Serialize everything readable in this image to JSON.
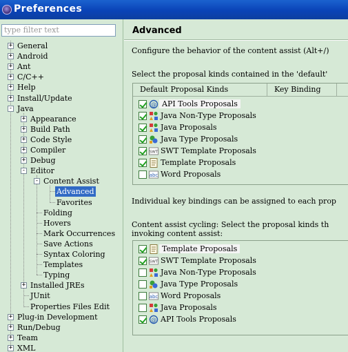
{
  "window": {
    "title": "Preferences"
  },
  "filter": {
    "placeholder": "type filter text"
  },
  "tree": [
    {
      "label": "General",
      "toggle": "+"
    },
    {
      "label": "Android",
      "toggle": "+"
    },
    {
      "label": "Ant",
      "toggle": "+"
    },
    {
      "label": "C/C++",
      "toggle": "+"
    },
    {
      "label": "Help",
      "toggle": "+"
    },
    {
      "label": "Install/Update",
      "toggle": "+"
    },
    {
      "label": "Java",
      "toggle": "-"
    },
    {
      "label": "Appearance",
      "toggle": "+"
    },
    {
      "label": "Build Path",
      "toggle": "+"
    },
    {
      "label": "Code Style",
      "toggle": "+"
    },
    {
      "label": "Compiler",
      "toggle": "+"
    },
    {
      "label": "Debug",
      "toggle": "+"
    },
    {
      "label": "Editor",
      "toggle": "-"
    },
    {
      "label": "Content Assist",
      "toggle": "-"
    },
    {
      "label": "Advanced",
      "toggle": ""
    },
    {
      "label": "Favorites",
      "toggle": ""
    },
    {
      "label": "Folding",
      "toggle": ""
    },
    {
      "label": "Hovers",
      "toggle": ""
    },
    {
      "label": "Mark Occurrences",
      "toggle": ""
    },
    {
      "label": "Save Actions",
      "toggle": ""
    },
    {
      "label": "Syntax Coloring",
      "toggle": ""
    },
    {
      "label": "Templates",
      "toggle": ""
    },
    {
      "label": "Typing",
      "toggle": ""
    },
    {
      "label": "Installed JREs",
      "toggle": "+"
    },
    {
      "label": "JUnit",
      "toggle": ""
    },
    {
      "label": "Properties Files Edit",
      "toggle": ""
    },
    {
      "label": "Plug-in Development",
      "toggle": "+"
    },
    {
      "label": "Run/Debug",
      "toggle": "+"
    },
    {
      "label": "Team",
      "toggle": "+"
    },
    {
      "label": "XML",
      "toggle": "+"
    }
  ],
  "page": {
    "title": "Advanced",
    "description": "Configure the behavior of the content assist (Alt+/)",
    "default_section_label": "Select the proposal kinds contained in the 'default'",
    "columns": {
      "kinds": "Default Proposal Kinds",
      "binding": "Key Binding"
    },
    "default_kinds": [
      {
        "label": "API Tools Proposals",
        "checked": true,
        "icon": "api-tools-icon"
      },
      {
        "label": "Java Non-Type Proposals",
        "checked": true,
        "icon": "java-non-type-icon"
      },
      {
        "label": "Java Proposals",
        "checked": true,
        "icon": "java-proposals-icon"
      },
      {
        "label": "Java Type Proposals",
        "checked": true,
        "icon": "java-type-icon"
      },
      {
        "label": "SWT Template Proposals",
        "checked": true,
        "icon": "swt-template-icon"
      },
      {
        "label": "Template Proposals",
        "checked": true,
        "icon": "template-icon"
      },
      {
        "label": "Word Proposals",
        "checked": false,
        "icon": "word-icon"
      }
    ],
    "key_bindings_note": "Individual key bindings can be assigned to each prop",
    "cycling_label_line1": "Content assist cycling: Select the proposal kinds th",
    "cycling_label_line2": "invoking content assist:",
    "cycling_kinds": [
      {
        "label": "Template Proposals",
        "checked": true,
        "icon": "template-icon"
      },
      {
        "label": "SWT Template Proposals",
        "checked": true,
        "icon": "swt-template-icon"
      },
      {
        "label": "Java Non-Type Proposals",
        "checked": false,
        "icon": "java-non-type-icon"
      },
      {
        "label": "Java Type Proposals",
        "checked": false,
        "icon": "java-type-icon"
      },
      {
        "label": "Word Proposals",
        "checked": false,
        "icon": "word-icon"
      },
      {
        "label": "Java Proposals",
        "checked": false,
        "icon": "java-proposals-icon"
      },
      {
        "label": "API Tools Proposals",
        "checked": true,
        "icon": "api-tools-icon"
      }
    ]
  }
}
